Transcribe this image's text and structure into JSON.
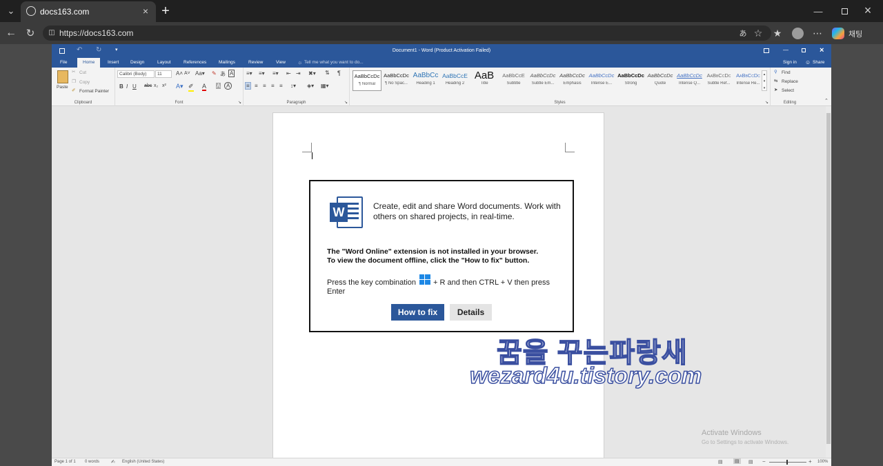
{
  "browser": {
    "tab_title": "docs163.com",
    "url": "https://docs163.com",
    "profile_label": "채팅"
  },
  "word": {
    "window_title": "Document1 - Word (Product Activation Failed)",
    "tabs": [
      "File",
      "Home",
      "Insert",
      "Design",
      "Layout",
      "References",
      "Mailings",
      "Review",
      "View"
    ],
    "tell_me": "Tell me what you want to do...",
    "sign_in": "Sign in",
    "share": "Share",
    "clipboard": {
      "paste": "Paste",
      "cut": "Cut",
      "copy": "Copy",
      "format_painter": "Format Painter",
      "label": "Clipboard"
    },
    "font": {
      "name": "Calibri (Body)",
      "size": "11",
      "label": "Font"
    },
    "paragraph_label": "Paragraph",
    "styles_label": "Styles",
    "styles": [
      {
        "preview": "AaBbCcDc",
        "name": "¶ Normal"
      },
      {
        "preview": "AaBbCcDc",
        "name": "¶ No Spac..."
      },
      {
        "preview": "AaBbCc",
        "name": "Heading 1"
      },
      {
        "preview": "AaBbCcE",
        "name": "Heading 2"
      },
      {
        "preview": "AaB",
        "name": "Title"
      },
      {
        "preview": "AaBbCcE",
        "name": "Subtitle"
      },
      {
        "preview": "AaBbCcDc",
        "name": "Subtle Em..."
      },
      {
        "preview": "AaBbCcDc",
        "name": "Emphasis"
      },
      {
        "preview": "AaBbCcDc",
        "name": "Intense E..."
      },
      {
        "preview": "AaBbCcDc",
        "name": "Strong"
      },
      {
        "preview": "AaBbCcDc",
        "name": "Quote"
      },
      {
        "preview": "AaBbCcDc",
        "name": "Intense Q..."
      },
      {
        "preview": "AaBbCcDc",
        "name": "Subtle Ref..."
      },
      {
        "preview": "AaBbCcDc",
        "name": "Intense Re..."
      }
    ],
    "editing": {
      "find": "Find",
      "replace": "Replace",
      "select": "Select",
      "label": "Editing"
    },
    "status": {
      "page": "Page 1 of 1",
      "words": "0 words",
      "language": "English (United States)",
      "zoom": "100%"
    }
  },
  "popup": {
    "headline": "Create, edit and share Word documents. Work with others on shared projects, in real-time.",
    "warning_line1": "The \"Word Online\" extension is not installed in your browser.",
    "warning_line2": "To view the document offline, click the \"How to fix\" button.",
    "instruction_part1": "Press the key combination",
    "instruction_part2": "+ R and then CTRL + V then press Enter",
    "how_to_fix": "How to fix",
    "details": "Details"
  },
  "watermark": {
    "line1": "꿈을 꾸는파랑새",
    "line2": "wezard4u.tistory.com"
  },
  "activate": {
    "title": "Activate Windows",
    "subtitle": "Go to Settings to activate Windows."
  },
  "colors": {
    "word_blue": "#2b579a",
    "btn_blue": "#2b579a"
  }
}
